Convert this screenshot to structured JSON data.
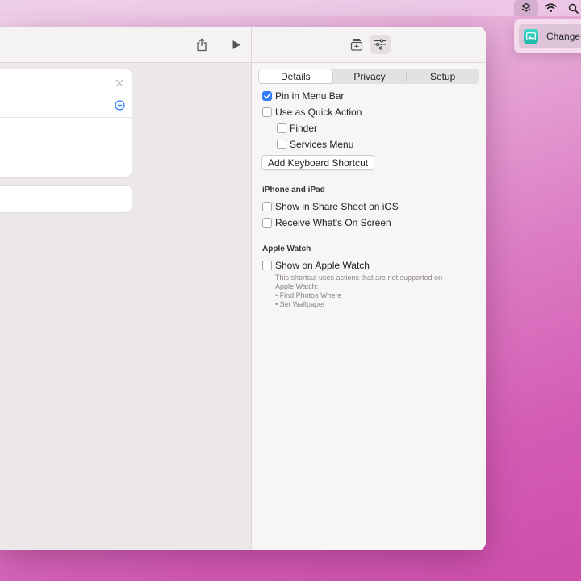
{
  "menubar": {
    "icons": [
      "shortcuts-menu-icon",
      "wifi-icon",
      "search-icon"
    ]
  },
  "menu_popup": {
    "item_label": "Change"
  },
  "toolbar": {
    "share_icon": "share-icon",
    "run_icon": "play-icon",
    "library_icon": "add-to-library-icon",
    "details_icon": "sliders-icon"
  },
  "details_panel": {
    "tabs": [
      {
        "label": "Details",
        "selected": true
      },
      {
        "label": "Privacy",
        "selected": false
      },
      {
        "label": "Setup",
        "selected": false
      }
    ],
    "pin_in_menu_bar": {
      "label": "Pin in Menu Bar",
      "checked": true
    },
    "use_as_quick_action": {
      "label": "Use as Quick Action",
      "checked": false
    },
    "finder": {
      "label": "Finder",
      "checked": false
    },
    "services_menu": {
      "label": "Services Menu",
      "checked": false
    },
    "add_keyboard_shortcut": "Add Keyboard Shortcut",
    "iphone_section": {
      "title": "iPhone and iPad",
      "share_sheet": {
        "label": "Show in Share Sheet on iOS",
        "checked": false
      },
      "whats_on_screen": {
        "label": "Receive What's On Screen",
        "checked": false
      }
    },
    "watch_section": {
      "title": "Apple Watch",
      "show_on_watch": {
        "label": "Show on Apple Watch",
        "checked": false
      },
      "note_lines": [
        "This shortcut uses actions that are not supported on",
        "Apple Watch:",
        "• Find Photos Where",
        "• Set Wallpaper"
      ]
    }
  },
  "colors": {
    "accent": "#2e7cf6",
    "desktop_top": "#f3d7ef",
    "desktop_bottom": "#cd4fab"
  }
}
